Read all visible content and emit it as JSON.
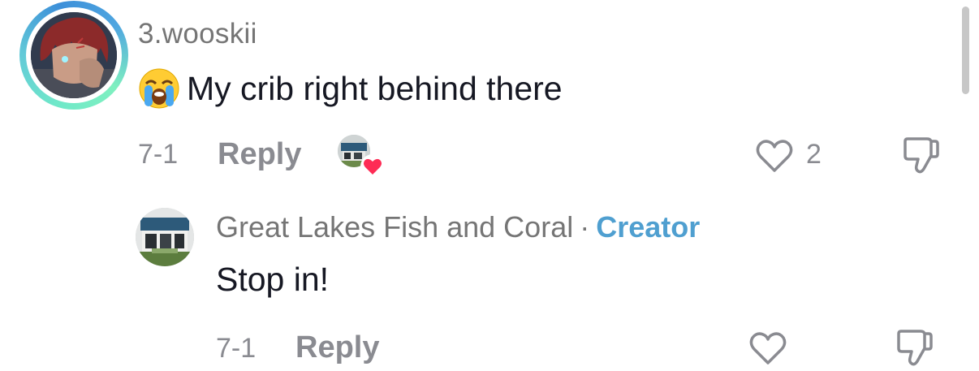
{
  "comment": {
    "username": "3.wooskii",
    "emoji": "loudly-crying-face-emoji",
    "text": "My crib right behind there",
    "date": "7-1",
    "reply_label": "Reply",
    "likes": "2"
  },
  "reply": {
    "author": "Great Lakes Fish and Coral",
    "separator": "·",
    "badge": "Creator",
    "text": "Stop in!",
    "date": "7-1",
    "reply_label": "Reply"
  },
  "icons": {
    "like": "heart-outline-icon",
    "dislike": "thumbs-down-outline-icon",
    "liked_by_creator": "heart-filled-icon"
  },
  "colors": {
    "creator_badge": "#4f9fd0",
    "liked_heart": "#fe2c55",
    "muted_text": "#8a8b91",
    "avatar_ring": "#6fe8c9"
  }
}
